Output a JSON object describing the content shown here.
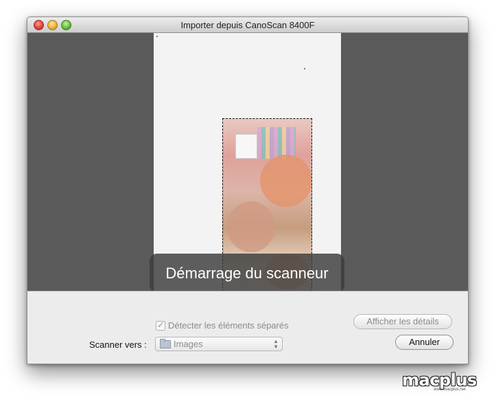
{
  "window": {
    "title": "Importer depuis CanoScan 8400F"
  },
  "preview": {
    "status_message": "Démarrage du scanneur"
  },
  "options": {
    "detect_separate_label": "Détecter les éléments séparés",
    "detect_separate_checked": true,
    "scan_to_label": "Scanner vers :",
    "scan_to_value": "Images",
    "show_details_label": "Afficher les détails",
    "cancel_label": "Annuler"
  },
  "watermark": {
    "brand": "macplus",
    "url": "www.macplus.net"
  },
  "icons": {
    "close": "close-button",
    "minimize": "minimize-button",
    "zoom": "zoom-button",
    "folder": "folder-icon",
    "popup_arrows": "popup-arrows-icon",
    "checkmark": "checkmark-icon"
  }
}
